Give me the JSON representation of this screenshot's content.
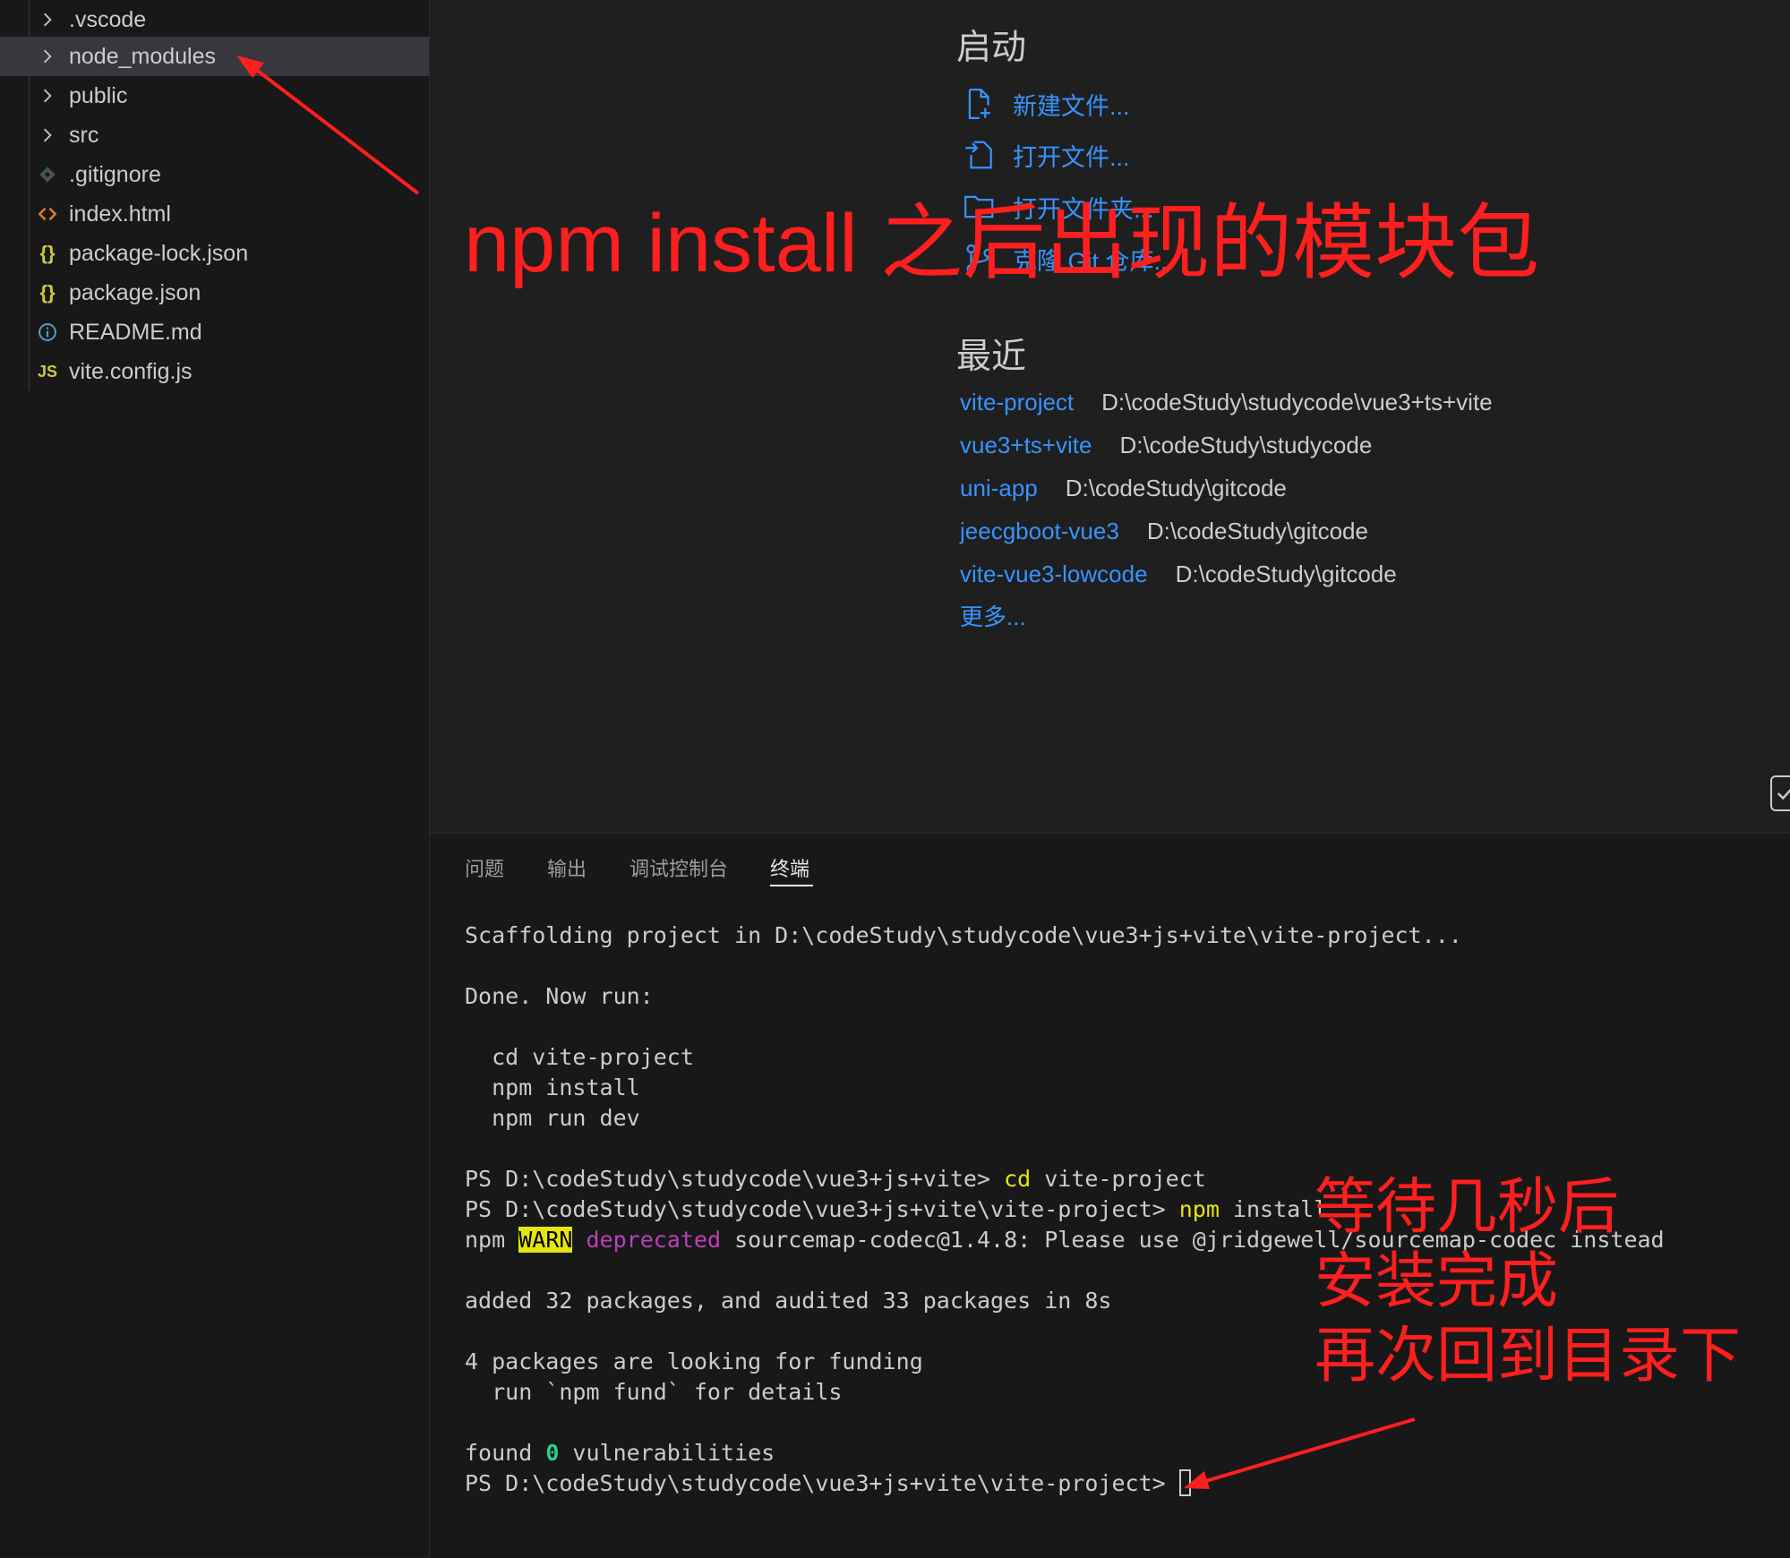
{
  "explorer": {
    "items": [
      {
        "label": ".vscode",
        "icon": "chevron-right-icon",
        "type": "folder"
      },
      {
        "label": "node_modules",
        "icon": "chevron-right-icon",
        "type": "folder",
        "selected": true
      },
      {
        "label": "public",
        "icon": "chevron-right-icon",
        "type": "folder"
      },
      {
        "label": "src",
        "icon": "chevron-right-icon",
        "type": "folder"
      },
      {
        "label": ".gitignore",
        "icon": "git-icon",
        "type": "file"
      },
      {
        "label": "index.html",
        "icon": "html-icon",
        "type": "file"
      },
      {
        "label": "package-lock.json",
        "icon": "json-icon",
        "glyph": "{}",
        "type": "file"
      },
      {
        "label": "package.json",
        "icon": "json-icon",
        "glyph": "{}",
        "type": "file"
      },
      {
        "label": "README.md",
        "icon": "info-icon",
        "type": "file"
      },
      {
        "label": "vite.config.js",
        "icon": "js-icon",
        "glyph": "JS",
        "type": "file"
      }
    ]
  },
  "welcome": {
    "start": {
      "title": "启动",
      "items": [
        {
          "label": "新建文件...",
          "icon": "new-file-icon"
        },
        {
          "label": "打开文件...",
          "icon": "open-file-icon"
        },
        {
          "label": "打开文件夹...",
          "icon": "open-folder-icon"
        },
        {
          "label": "克隆 Git 仓库...",
          "icon": "git-clone-icon"
        }
      ]
    },
    "recent": {
      "title": "最近",
      "items": [
        {
          "name": "vite-project",
          "path": "D:\\codeStudy\\studycode\\vue3+ts+vite"
        },
        {
          "name": "vue3+ts+vite",
          "path": "D:\\codeStudy\\studycode"
        },
        {
          "name": "uni-app",
          "path": "D:\\codeStudy\\gitcode"
        },
        {
          "name": "jeecgboot-vue3",
          "path": "D:\\codeStudy\\gitcode"
        },
        {
          "name": "vite-vue3-lowcode",
          "path": "D:\\codeStudy\\gitcode"
        }
      ],
      "more": "更多..."
    }
  },
  "panel": {
    "tabs": [
      {
        "label": "问题"
      },
      {
        "label": "输出"
      },
      {
        "label": "调试控制台"
      },
      {
        "label": "终端",
        "active": true
      }
    ]
  },
  "terminal": {
    "scaffolding": "Scaffolding project in D:\\codeStudy\\studycode\\vue3+js+vite\\vite-project...",
    "done": "Done. Now run:",
    "step1": "  cd vite-project",
    "step2": "  npm install",
    "step3": "  npm run dev",
    "prompt1": "PS D:\\codeStudy\\studycode\\vue3+js+vite> ",
    "cmd1_name": "cd",
    "cmd1_arg": " vite-project",
    "prompt2": "PS D:\\codeStudy\\studycode\\vue3+js+vite\\vite-project> ",
    "cmd2_name": "npm",
    "cmd2_arg": " install",
    "warn_prefix": "npm ",
    "warn_badge": "WARN",
    "warn_deprecated": "deprecated",
    "warn_rest": " sourcemap-codec@1.4.8: Please use @jridgewell/sourcemap-codec instead",
    "added": "added 32 packages, and audited 33 packages in 8s",
    "funding1": "4 packages are looking for funding",
    "funding2": "  run `npm fund` for details",
    "found_prefix": "found ",
    "found_count": "0",
    "found_suffix": " vulnerabilities",
    "prompt3": "PS D:\\codeStudy\\studycode\\vue3+js+vite\\vite-project> "
  },
  "annotations": {
    "top": "npm install 之后出现的模块包",
    "bottom_lines": [
      "等待几秒后",
      "安装完成",
      "再次回到目录下"
    ],
    "color": "#ff1f1f"
  },
  "colors": {
    "background": "#1f1f1f",
    "sidebar": "#181818",
    "link": "#3794ff",
    "selection": "#37373d"
  }
}
